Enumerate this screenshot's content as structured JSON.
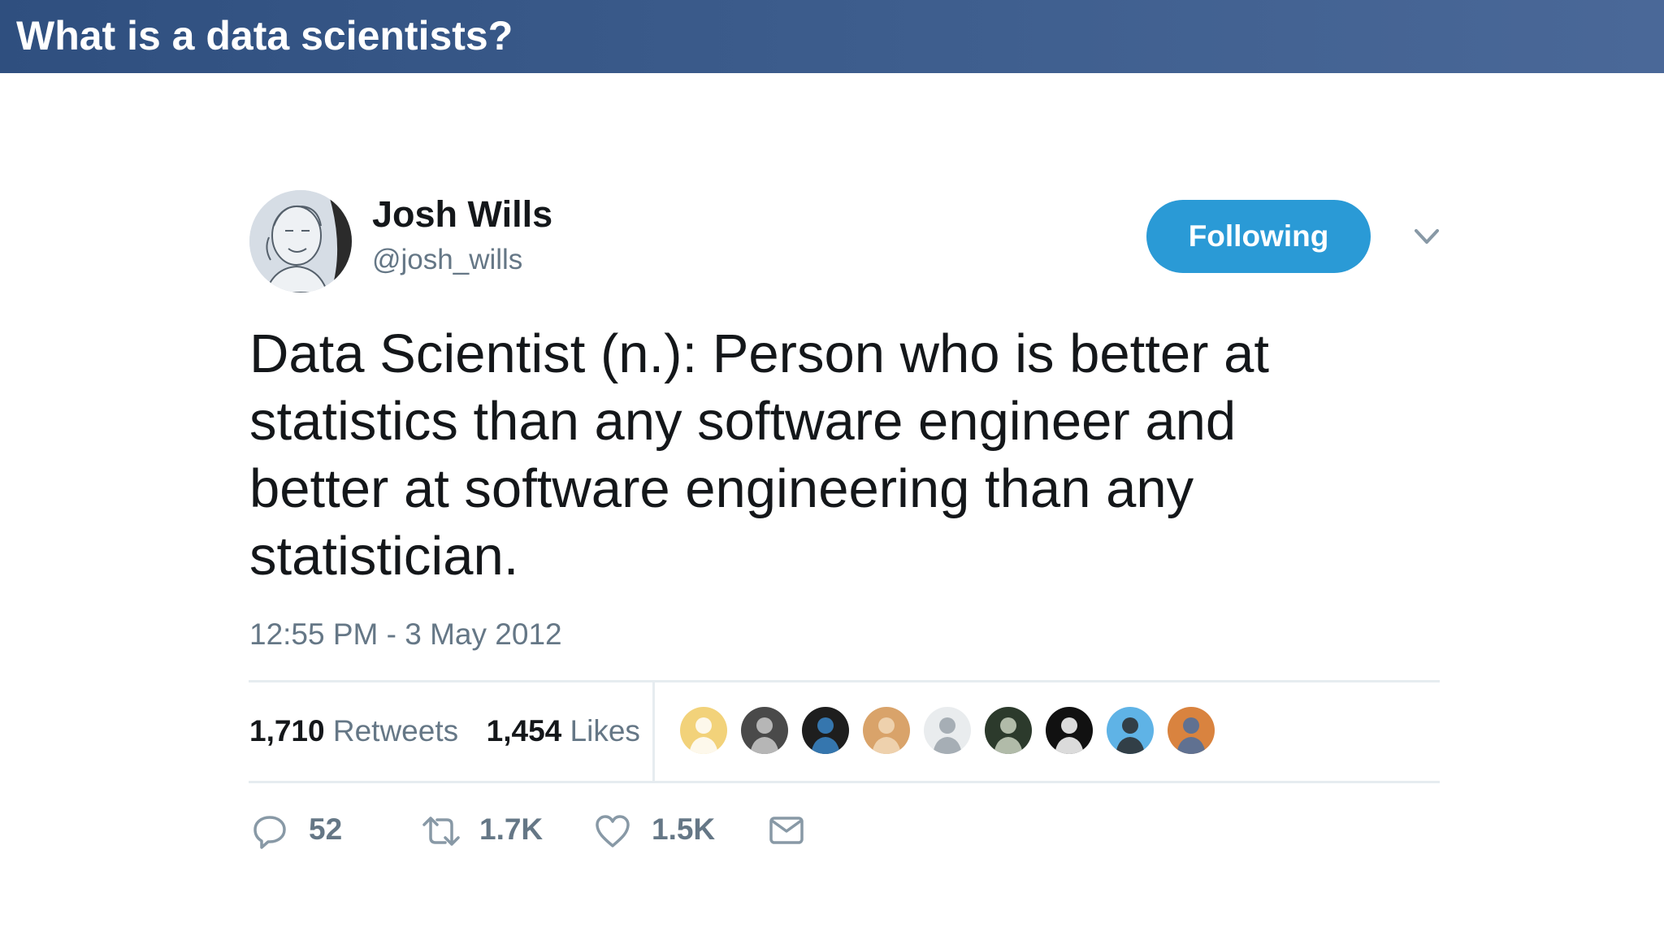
{
  "slide": {
    "title": "What is a data scientists?"
  },
  "tweet": {
    "author_name": "Josh Wills",
    "author_handle": "@josh_wills",
    "follow_label": "Following",
    "text": "Data Scientist (n.): Person who is better at\nstatistics than any software engineer and\nbetter at software engineering than any\nstatistician.",
    "timestamp": "12:55 PM - 3 May 2012",
    "retweets_count": "1,710",
    "retweets_label": "Retweets",
    "likes_count": "1,454",
    "likes_label": "Likes",
    "likers": [
      {
        "color": "#f2d27a",
        "accent": "#ffffff"
      },
      {
        "color": "#4a4a4a",
        "accent": "#c9c9c9"
      },
      {
        "color": "#1e1e1e",
        "accent": "#3a86c8"
      },
      {
        "color": "#d9a36a",
        "accent": "#f1d9b8"
      },
      {
        "color": "#e9ecee",
        "accent": "#9aa3aa"
      },
      {
        "color": "#2c3a2c",
        "accent": "#c9d2c0"
      },
      {
        "color": "#111111",
        "accent": "#ffffff"
      },
      {
        "color": "#5fb3e6",
        "accent": "#2a2a2a"
      },
      {
        "color": "#d9833f",
        "accent": "#4a6fa0"
      }
    ],
    "actions": {
      "reply_count": "52",
      "retweet_count": "1.7K",
      "like_count": "1.5K"
    },
    "colors": {
      "follow_button": "#2a9ad6",
      "text": "#14171a",
      "muted": "#657786",
      "divider": "#e6ecf0"
    }
  }
}
